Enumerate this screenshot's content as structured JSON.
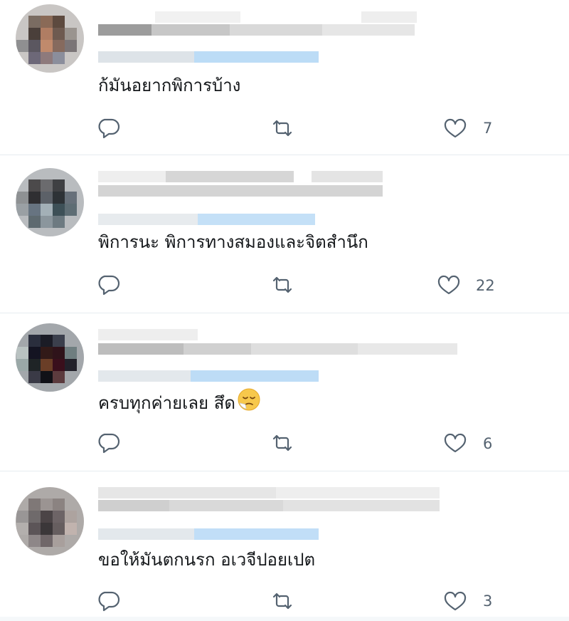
{
  "replies": [
    {
      "text": "ก้มันอยากพิการบ้าง",
      "emoji": "",
      "likes": "7",
      "author_visible": false
    },
    {
      "text": "พิการนะ พิการทางสมองและจิตสำนึก",
      "emoji": "",
      "likes": "22",
      "author_visible": false
    },
    {
      "text": "ครบทุกค่ายเลย สึด",
      "emoji": "relieved-face-emoji",
      "likes": "6",
      "author_visible": false
    },
    {
      "text": "ขอให้มันตกนรก อเวจีปอยเปต",
      "emoji": "",
      "likes": "3",
      "author_visible": false
    }
  ],
  "icons": {
    "reply": "reply-bubble-icon",
    "retweet": "retweet-arrows-icon",
    "like": "heart-outline-icon"
  },
  "colors": {
    "text": "#14171a",
    "icon": "#657786",
    "divider": "#e6ecf0",
    "handle_blur": "#cfe6f8"
  }
}
